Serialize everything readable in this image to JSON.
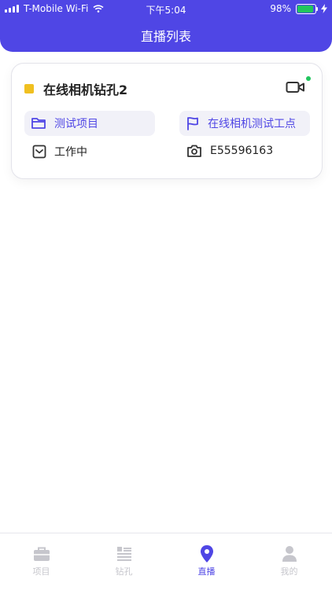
{
  "status_bar": {
    "carrier": "T-Mobile Wi-Fi",
    "time": "下午5:04",
    "battery": "98%"
  },
  "header": {
    "title": "直播列表"
  },
  "cards": [
    {
      "name": "在线相机钻孔2",
      "project": "测试项目",
      "site": "在线相机测试工点",
      "status": "工作中",
      "device_id": "E55596163"
    }
  ],
  "tabs": [
    {
      "label": "项目"
    },
    {
      "label": "钻孔"
    },
    {
      "label": "直播"
    },
    {
      "label": "我的"
    }
  ],
  "colors": {
    "primary": "#4f46e5",
    "status_square": "#f0c020",
    "online_dot": "#22c55e",
    "inactive": "#c6c6cc"
  }
}
